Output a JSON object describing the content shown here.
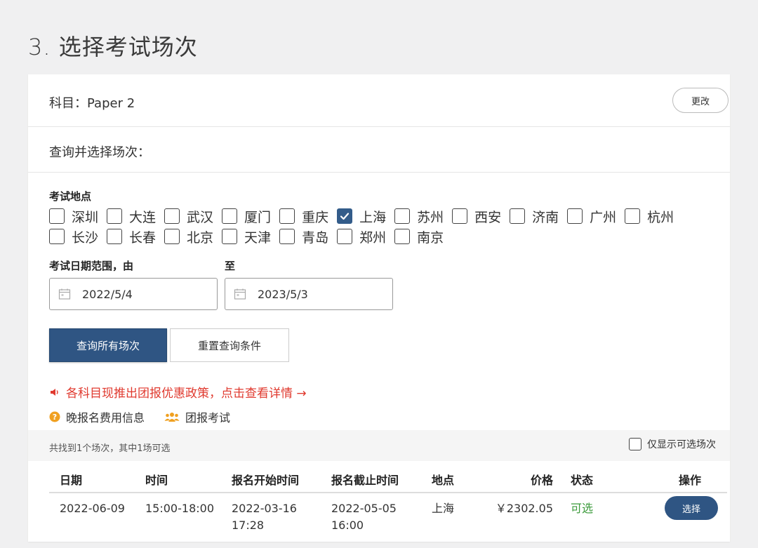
{
  "page": {
    "title": "3. 选择考试场次"
  },
  "subject": {
    "label": "科目：Paper 2",
    "change_label": "更改"
  },
  "query": {
    "label": "查询并选择场次："
  },
  "location": {
    "label": "考试地点",
    "row1": [
      {
        "name": "深圳",
        "checked": false
      },
      {
        "name": "大连",
        "checked": false
      },
      {
        "name": "武汉",
        "checked": false
      },
      {
        "name": "厦门",
        "checked": false
      },
      {
        "name": "重庆",
        "checked": false
      },
      {
        "name": "上海",
        "checked": true
      },
      {
        "name": "苏州",
        "checked": false
      },
      {
        "name": "西安",
        "checked": false
      },
      {
        "name": "济南",
        "checked": false
      },
      {
        "name": "广州",
        "checked": false
      },
      {
        "name": "杭州",
        "checked": false
      }
    ],
    "row2": [
      {
        "name": "长沙",
        "checked": false
      },
      {
        "name": "长春",
        "checked": false
      },
      {
        "name": "北京",
        "checked": false
      },
      {
        "name": "天津",
        "checked": false
      },
      {
        "name": "青岛",
        "checked": false
      },
      {
        "name": "郑州",
        "checked": false
      },
      {
        "name": "南京",
        "checked": false
      }
    ]
  },
  "date_range": {
    "from_label": "考试日期范围，由",
    "to_label": "至",
    "from_value": "2022/5/4",
    "to_value": "2023/5/3"
  },
  "actions": {
    "search_label": "查询所有场次",
    "reset_label": "重置查询条件"
  },
  "promo": {
    "text": "各科目现推出团报优惠政策，点击查看详情 →",
    "color": "#e03a2f"
  },
  "info": {
    "late_fee_label": "晚报名费用信息",
    "group_label": "团报考试"
  },
  "results": {
    "summary": "共找到1个场次，其中1场可选",
    "only_available_label": "仅显示可选场次"
  },
  "table": {
    "headers": [
      "日期",
      "时间",
      "报名开始时间",
      "报名截止时间",
      "地点",
      "价格",
      "状态",
      "操作"
    ],
    "rows": [
      {
        "date": "2022-06-09",
        "time": "15:00-18:00",
        "reg_start_date": "2022-03-16",
        "reg_start_time": "17:28",
        "reg_end_date": "2022-05-05",
        "reg_end_time": "16:00",
        "location": "上海",
        "price": "￥2302.05",
        "status": "可选",
        "action": "选择"
      }
    ]
  },
  "colors": {
    "primary": "#2f5583",
    "available": "#3a9a3a"
  }
}
